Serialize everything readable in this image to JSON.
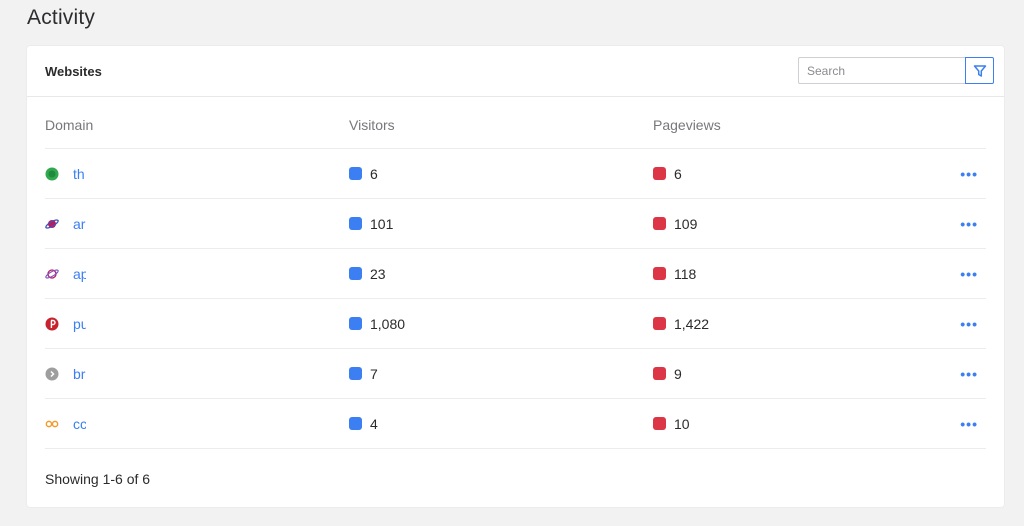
{
  "page": {
    "title": "Activity"
  },
  "card": {
    "title": "Websites",
    "search": {
      "placeholder": "Search",
      "value": ""
    },
    "filter_icon": "filter-icon"
  },
  "table": {
    "columns": [
      "Domain",
      "Visitors",
      "Pageviews"
    ],
    "rows": [
      {
        "domain": "th",
        "favicon": "green-circle-icon",
        "visitors": "6",
        "pageviews": "6"
      },
      {
        "domain": "ar",
        "favicon": "planet-icon",
        "visitors": "101",
        "pageviews": "109"
      },
      {
        "domain": "ap",
        "favicon": "planet-icon",
        "visitors": "23",
        "pageviews": "118"
      },
      {
        "domain": "pu",
        "favicon": "pinterest-icon",
        "visitors": "1,080",
        "pageviews": "1,422"
      },
      {
        "domain": "br",
        "favicon": "gray-chevron-circle-icon",
        "visitors": "7",
        "pageviews": "9"
      },
      {
        "domain": "cc",
        "favicon": "infinity-icon",
        "visitors": "4",
        "pageviews": "10"
      }
    ],
    "more_label": "•••"
  },
  "colors": {
    "visitors": "#3b7ff2",
    "pageviews": "#dc3545",
    "link": "#3b7ff2"
  },
  "footer": {
    "showing": "Showing 1-6 of 6"
  }
}
